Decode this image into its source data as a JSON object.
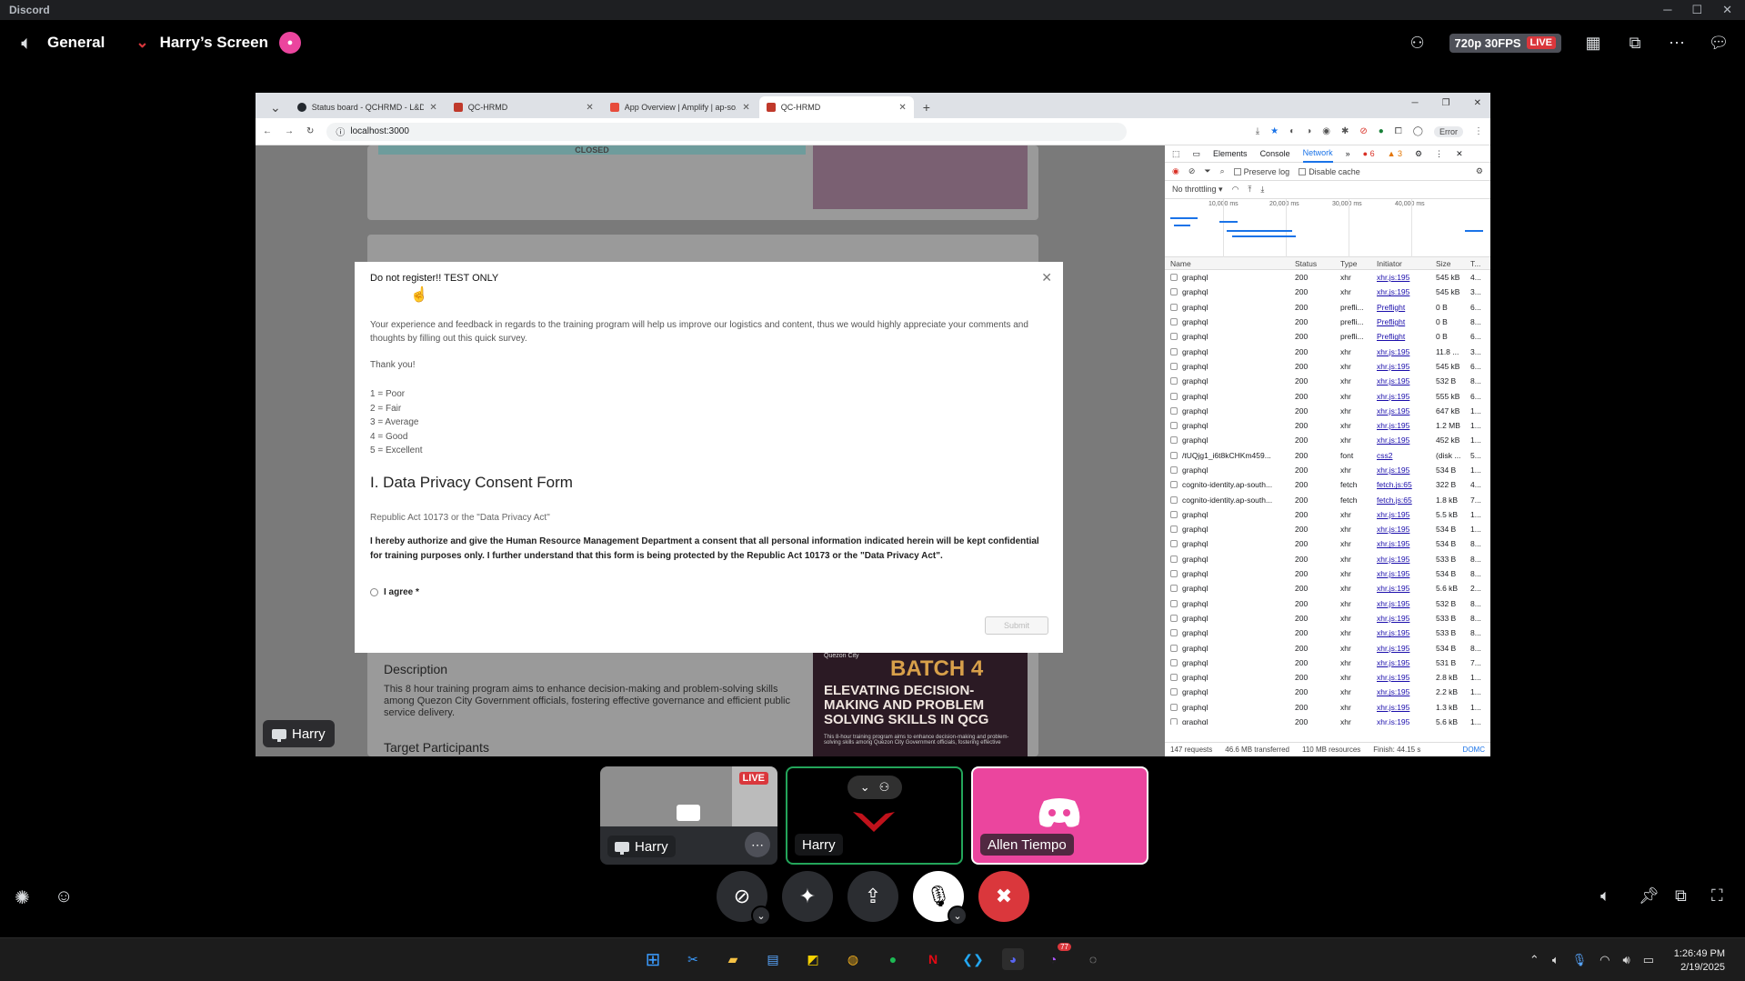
{
  "app": {
    "title": "Discord"
  },
  "call": {
    "channel": "General",
    "stream_title": "Harry’s Screen",
    "quality": "720p 30FPS",
    "live": "LIVE"
  },
  "browser": {
    "tabs": [
      {
        "label": "Status board - QCHRMD - L&D",
        "color": "#24292f"
      },
      {
        "label": "QC-HRMD",
        "color": "#c0392b"
      },
      {
        "label": "App Overview | Amplify | ap-so...",
        "color": "#e74c3c"
      },
      {
        "label": "QC-HRMD",
        "color": "#c0392b"
      }
    ],
    "url": "localhost:3000",
    "error_pill": "Error"
  },
  "page": {
    "closed": "CLOSED",
    "description_title": "Description",
    "description_body": "This 8 hour training program aims to enhance decision-making and problem-solving skills among Quezon City Government officials, fostering effective governance and efficient public service delivery.",
    "target": "Target Participants",
    "batch": {
      "brand": "Quezon City",
      "number": "BATCH 4",
      "headline": "ELEVATING DECISION-MAKING AND PROBLEM SOLVING SKILLS IN QCG",
      "fine": "This 8-hour training program aims to enhance decision-making and problem-solving skills among Quezon City Government officials, fostering effective"
    }
  },
  "modal": {
    "title": "Do not register!! TEST ONLY",
    "intro": "Your experience and feedback in regards to the training program will help us improve our logistics and content, thus we would highly appreciate your comments and thoughts by filling out this quick survey.",
    "thanks": "Thank you!",
    "scale": [
      "1 = Poor",
      "2 = Fair",
      "3 = Average",
      "4 = Good",
      "5 = Excellent"
    ],
    "heading": "I. Data Privacy Consent Form",
    "ra": "Republic Act 10173 or the \"Data Privacy Act\"",
    "consent": "I hereby authorize and give the Human Resource Management Department a consent that all personal information indicated herein will be kept confidential for training purposes only. I further understand that this form is being protected by the Republic Act 10173 or the \"Data Privacy Act\".",
    "agree": "I agree *",
    "submit": "Submit"
  },
  "devtools": {
    "tabs": [
      "Elements",
      "Console",
      "Network"
    ],
    "errors": "6",
    "warnings": "3",
    "preserve_log": "Preserve log",
    "disable_cache": "Disable cache",
    "throttling": "No throttling",
    "timeline": [
      "10,000 ms",
      "20,000 ms",
      "30,000 ms",
      "40,000 ms"
    ],
    "columns": [
      "Name",
      "Status",
      "Type",
      "Initiator",
      "Size",
      "T..."
    ],
    "rows": [
      [
        "graphql",
        "200",
        "xhr",
        "xhr.js:195",
        "545 kB",
        "4..."
      ],
      [
        "graphql",
        "200",
        "xhr",
        "xhr.js:195",
        "545 kB",
        "3..."
      ],
      [
        "graphql",
        "200",
        "prefli...",
        "Preflight",
        "0 B",
        "6..."
      ],
      [
        "graphql",
        "200",
        "prefli...",
        "Preflight",
        "0 B",
        "8..."
      ],
      [
        "graphql",
        "200",
        "prefli...",
        "Preflight",
        "0 B",
        "6..."
      ],
      [
        "graphql",
        "200",
        "xhr",
        "xhr.js:195",
        "11.8 ...",
        "3..."
      ],
      [
        "graphql",
        "200",
        "xhr",
        "xhr.js:195",
        "545 kB",
        "6..."
      ],
      [
        "graphql",
        "200",
        "xhr",
        "xhr.js:195",
        "532 B",
        "8..."
      ],
      [
        "graphql",
        "200",
        "xhr",
        "xhr.js:195",
        "555 kB",
        "6..."
      ],
      [
        "graphql",
        "200",
        "xhr",
        "xhr.js:195",
        "647 kB",
        "1..."
      ],
      [
        "graphql",
        "200",
        "xhr",
        "xhr.js:195",
        "1.2 MB",
        "1..."
      ],
      [
        "graphql",
        "200",
        "xhr",
        "xhr.js:195",
        "452 kB",
        "1..."
      ],
      [
        "/tUQjg1_i6t8kCHKm459...",
        "200",
        "font",
        "css2",
        "(disk ...",
        "5..."
      ],
      [
        "graphql",
        "200",
        "xhr",
        "xhr.js:195",
        "534 B",
        "1..."
      ],
      [
        "cognito-identity.ap-south...",
        "200",
        "fetch",
        "fetch.js:65",
        "322 B",
        "4..."
      ],
      [
        "cognito-identity.ap-south...",
        "200",
        "fetch",
        "fetch.js:65",
        "1.8 kB",
        "7..."
      ],
      [
        "graphql",
        "200",
        "xhr",
        "xhr.js:195",
        "5.5 kB",
        "1..."
      ],
      [
        "graphql",
        "200",
        "xhr",
        "xhr.js:195",
        "534 B",
        "1..."
      ],
      [
        "graphql",
        "200",
        "xhr",
        "xhr.js:195",
        "534 B",
        "8..."
      ],
      [
        "graphql",
        "200",
        "xhr",
        "xhr.js:195",
        "533 B",
        "8..."
      ],
      [
        "graphql",
        "200",
        "xhr",
        "xhr.js:195",
        "534 B",
        "8..."
      ],
      [
        "graphql",
        "200",
        "xhr",
        "xhr.js:195",
        "5.6 kB",
        "2..."
      ],
      [
        "graphql",
        "200",
        "xhr",
        "xhr.js:195",
        "532 B",
        "8..."
      ],
      [
        "graphql",
        "200",
        "xhr",
        "xhr.js:195",
        "533 B",
        "8..."
      ],
      [
        "graphql",
        "200",
        "xhr",
        "xhr.js:195",
        "533 B",
        "8..."
      ],
      [
        "graphql",
        "200",
        "xhr",
        "xhr.js:195",
        "534 B",
        "8..."
      ],
      [
        "graphql",
        "200",
        "xhr",
        "xhr.js:195",
        "531 B",
        "7..."
      ],
      [
        "graphql",
        "200",
        "xhr",
        "xhr.js:195",
        "2.8 kB",
        "1..."
      ],
      [
        "graphql",
        "200",
        "xhr",
        "xhr.js:195",
        "2.2 kB",
        "1..."
      ],
      [
        "graphql",
        "200",
        "xhr",
        "xhr.js:195",
        "1.3 kB",
        "1..."
      ],
      [
        "graphql",
        "200",
        "xhr",
        "xhr.js:195",
        "5.6 kB",
        "1..."
      ]
    ],
    "status": [
      "147 requests",
      "46.6 MB transferred",
      "110 MB resources",
      "Finish: 44.15 s",
      "DOMC"
    ]
  },
  "participants": [
    {
      "name": "Harry",
      "live": "LIVE"
    },
    {
      "name": "Harry"
    },
    {
      "name": "Allen Tiempo"
    }
  ],
  "stream_label": "Harry",
  "clock": {
    "time": "1:26:49 PM",
    "date": "2/19/2025"
  },
  "taskbar_badges": {
    "messenger": "77"
  }
}
